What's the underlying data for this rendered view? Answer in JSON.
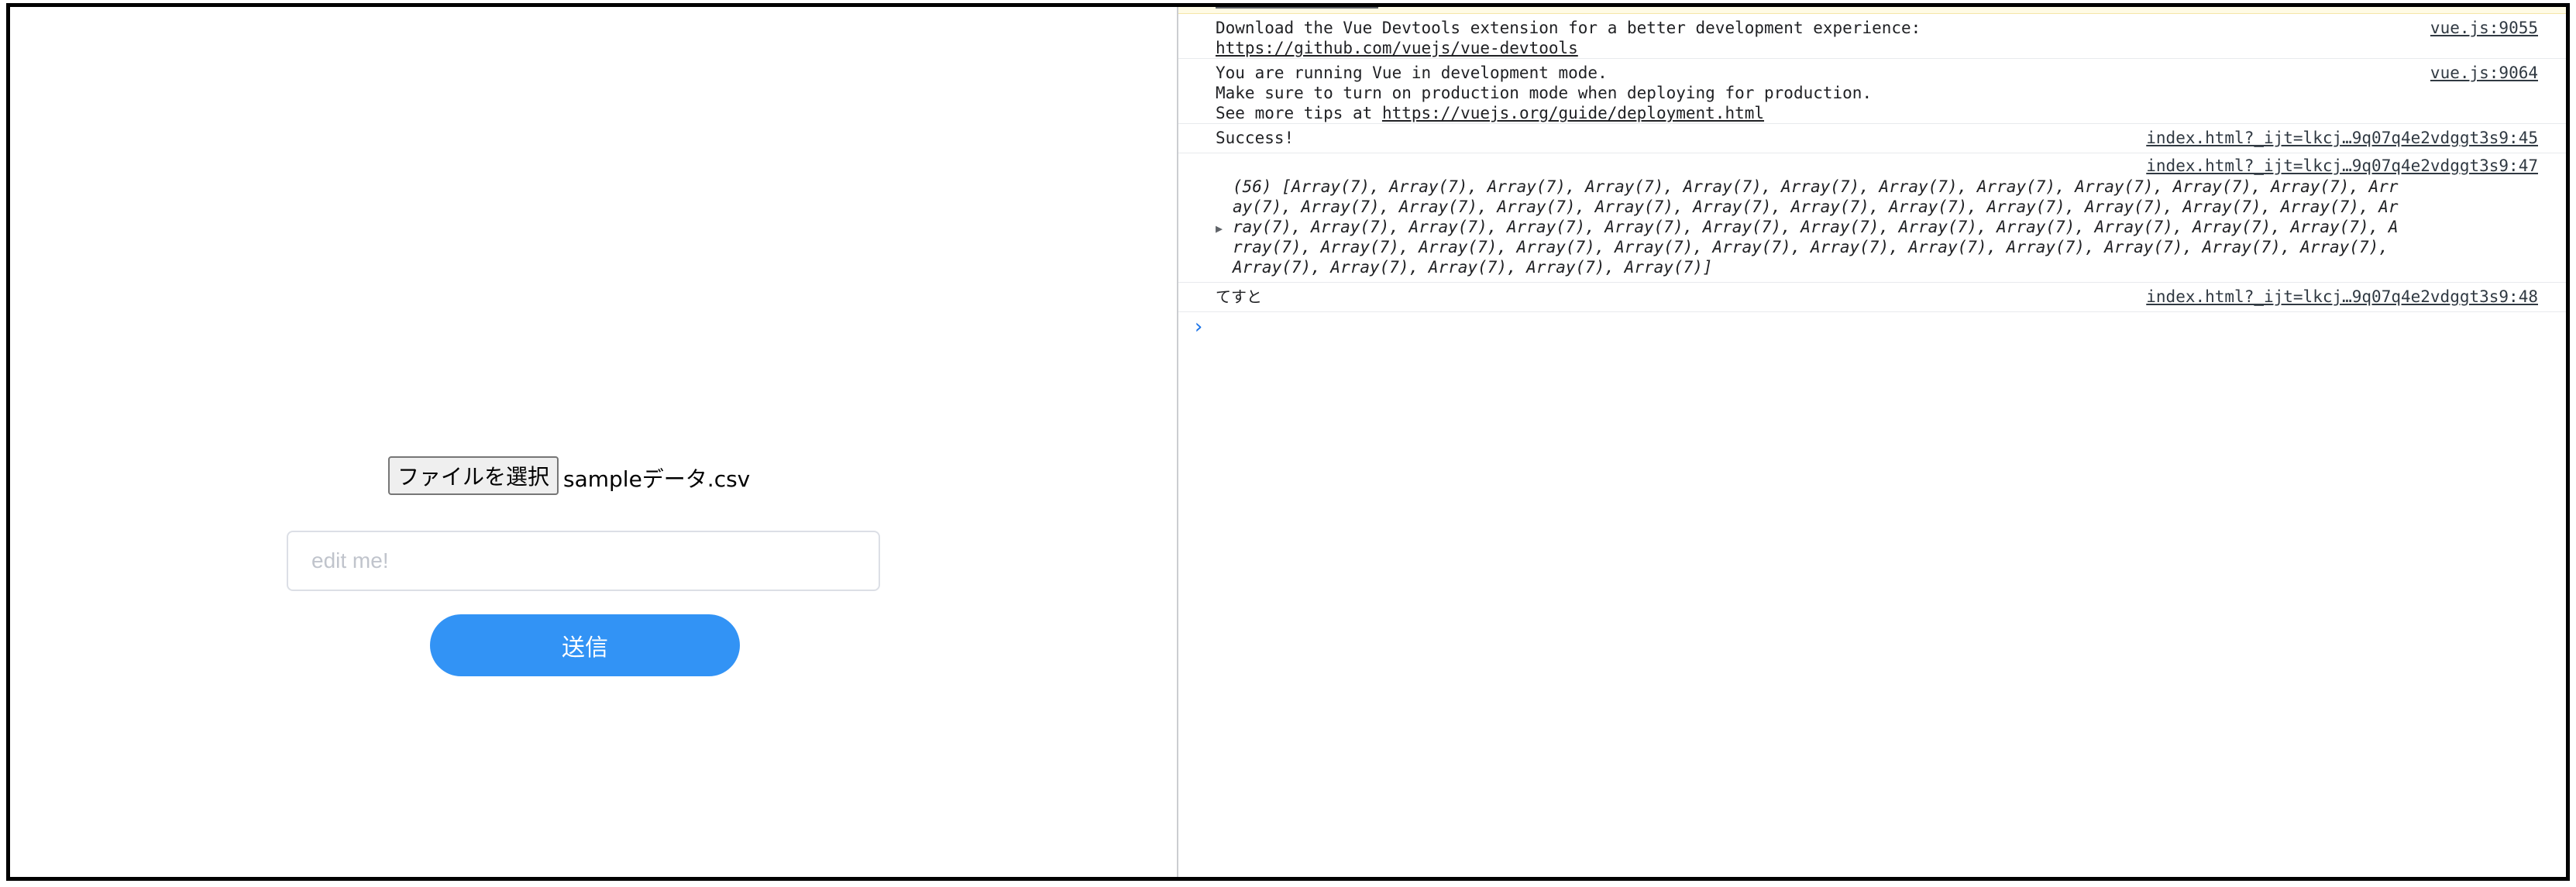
{
  "app": {
    "file_button_label": "ファイルを選択",
    "file_name": "sampleデータ.csv",
    "input_placeholder": "edit me!",
    "submit_label": "送信"
  },
  "console": {
    "messages": [
      {
        "lines": [
          "Download the Vue Devtools extension for a better development experience:"
        ],
        "link": "https://github.com/vuejs/vue-devtools",
        "source": "vue.js:9055"
      },
      {
        "lines": [
          "You are running Vue in development mode.",
          "Make sure to turn on production mode when deploying for production."
        ],
        "tip_prefix": "See more tips at ",
        "link": "https://vuejs.org/guide/deployment.html",
        "source": "vue.js:9064"
      },
      {
        "text": "Success!",
        "source": "index.html?_ijt=lkcj…9q07q4e2vdggt3s9:45"
      },
      {
        "source": "index.html?_ijt=lkcj…9q07q4e2vdggt3s9:47",
        "array_lines": [
          "(56) [Array(7), Array(7), Array(7), Array(7), Array(7), Array(7), Array(7), Array(7), Array(7), Array(7), Array(7), Arr",
          "ay(7), Array(7), Array(7), Array(7), Array(7), Array(7), Array(7), Array(7), Array(7), Array(7), Array(7), Array(7), Ar",
          "ray(7), Array(7), Array(7), Array(7), Array(7), Array(7), Array(7), Array(7), Array(7), Array(7), Array(7), Array(7), A",
          "rray(7), Array(7), Array(7), Array(7), Array(7), Array(7), Array(7), Array(7), Array(7), Array(7), Array(7), Array(7),",
          "Array(7), Array(7), Array(7), Array(7), Array(7)]"
        ]
      },
      {
        "text": "てすと",
        "source": "index.html?_ijt=lkcj…9q07q4e2vdggt3s9:48"
      }
    ],
    "prompt_symbol": "›"
  },
  "colors": {
    "submit_button": "#3293f5",
    "console_prompt": "#1a73e8",
    "warning_background": "#fffbe5"
  }
}
